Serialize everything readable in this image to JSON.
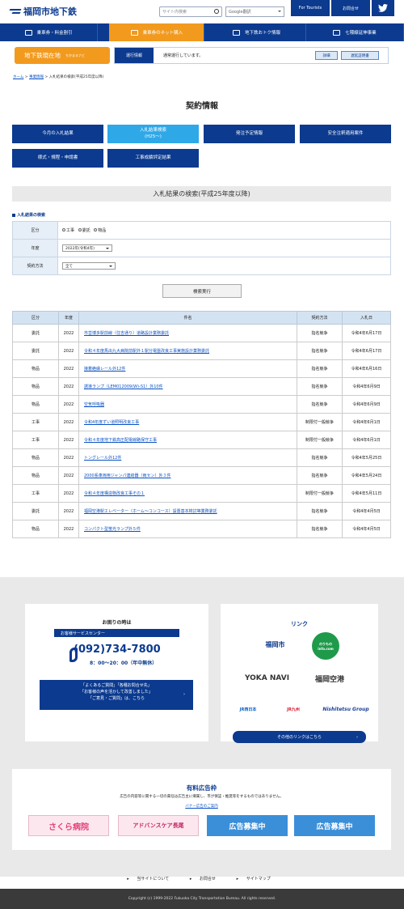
{
  "header": {
    "logo": "福岡市地下鉄",
    "search_placeholder": "サイト内検索",
    "google_translate": "Google翻訳",
    "for_tourists": "For Tourists",
    "contact": "お問合せ"
  },
  "nav": [
    {
      "label": "乗車券・料金割引",
      "icon": "ticket-icon"
    },
    {
      "label": "乗車券のネット購入",
      "icon": "cart-icon"
    },
    {
      "label": "地下鉄おトク情報",
      "icon": "train-icon"
    },
    {
      "label": "七隈線延伸事業",
      "icon": "construction-icon"
    }
  ],
  "train": {
    "location": "地下鉄現在地",
    "location_sub": "ちかまるナビ",
    "status_label": "運行情報",
    "status_text": "通常運行しています。",
    "detail": "詳細",
    "delay_cert": "遅延証明書"
  },
  "breadcrumb": {
    "home": "ホーム",
    "parent": "事業情報",
    "current": "入札結果の検索(平成25年度以降)"
  },
  "page_title": "契約情報",
  "tabs": [
    "今月の入札結果",
    "入札結果検索\n(H25〜)",
    "発注予定情報",
    "安全注釈適用案件",
    "様式・規程・申請書",
    "工事成績評定結果"
  ],
  "section_title": "入札結果の検索(平成25年度以降)",
  "form": {
    "title": "入札結果の検索",
    "category_label": "区分",
    "categories": [
      "工事",
      "委託",
      "物品"
    ],
    "year_label": "年度",
    "year_value": "2022年(令和4年)",
    "method_label": "契約方法",
    "method_value": "全て",
    "submit": "検索実行"
  },
  "results": {
    "headers": [
      "区分",
      "年度",
      "件名",
      "契約方法",
      "入札日"
    ],
    "rows": [
      [
        "委託",
        "2022",
        "市営博多駅前線（住吉通り）道路設計業務委託",
        "指名競争",
        "令和4年6月17日"
      ],
      [
        "委託",
        "2022",
        "令和４年度馬出九大病院前駅外１駅分電盤改良工事実施設計業務委託",
        "指名競争",
        "令和4年6月17日"
      ],
      [
        "物品",
        "2022",
        "接着絶縁レール外12件",
        "指名競争",
        "令和4年6月16日"
      ],
      [
        "物品",
        "2022",
        "誘導ランプ（LEM012009(W)-S1）外10件",
        "指名競争",
        "令和4年6月9日"
      ],
      [
        "物品",
        "2022",
        "空気呼吸器",
        "指名競争",
        "令和4年6月9日"
      ],
      [
        "工事",
        "2022",
        "令和4年度ずい道照明改良工事",
        "制限付一般競争",
        "令和4年6月1日"
      ],
      [
        "工事",
        "2022",
        "令和４年度地下鉄高圧配電線路保守工事",
        "制限付一般競争",
        "令和4年6月1日"
      ],
      [
        "物品",
        "2022",
        "トングレール外12件",
        "指名競争",
        "令和4年5月25日"
      ],
      [
        "物品",
        "2022",
        "2000系車両用ジャンパ連結器（両セン）外３件",
        "指名競争",
        "令和4年5月24日"
      ],
      [
        "工事",
        "2022",
        "令和４年度構造物改良工事その１",
        "制限付一般競争",
        "令和4年5月11日"
      ],
      [
        "委託",
        "2022",
        "福岡空港駅エレベーター（ホーム〜コンコース）設置基本検討等業務委託",
        "指名競争",
        "令和4年4月5日"
      ],
      [
        "物品",
        "2022",
        "コンパクト型蛍光ランプ外５件",
        "指名競争",
        "令和4年4月5日"
      ]
    ]
  },
  "help": {
    "title": "お困りの時は",
    "center": "お客様サービスセンター",
    "tel": "(092)734-7800",
    "hours": "8：00〜20：00（年中無休）",
    "faq_lines": [
      "「よくあるご質問」「各種お問合せ先」",
      "「お客様の声を活かして改善しました」",
      "「ご意見・ご質問」は、こちら"
    ]
  },
  "links": {
    "title": "リンク",
    "items": [
      "福岡市",
      "のりもの info.com",
      "YOKA NAVI",
      "福岡空港",
      "JR西日本",
      "JR九州",
      "Nishitetsu Group"
    ],
    "more": "その他のリンクはこちら"
  },
  "ads": {
    "title": "有料広告枠",
    "disclaimer": "広告の内容等に関する一切の責任は広告主に帰属し、市が保証・推奨等をするものではありません。",
    "link": "バナー広告のご案内",
    "banners": [
      "さくら病院",
      "アドバンスケア長尾",
      "広告募集中",
      "広告募集中"
    ]
  },
  "footer_links": [
    "当サイトについて",
    "お問合せ",
    "サイトマップ"
  ],
  "copyright": "Copyright (c) 1999-2022 Fukuoka City Transportation Bureau. All rights reserved.",
  "colors": {
    "navy": "#0b3a8f",
    "orange": "#f29a1e",
    "sky": "#2fa8e8"
  }
}
